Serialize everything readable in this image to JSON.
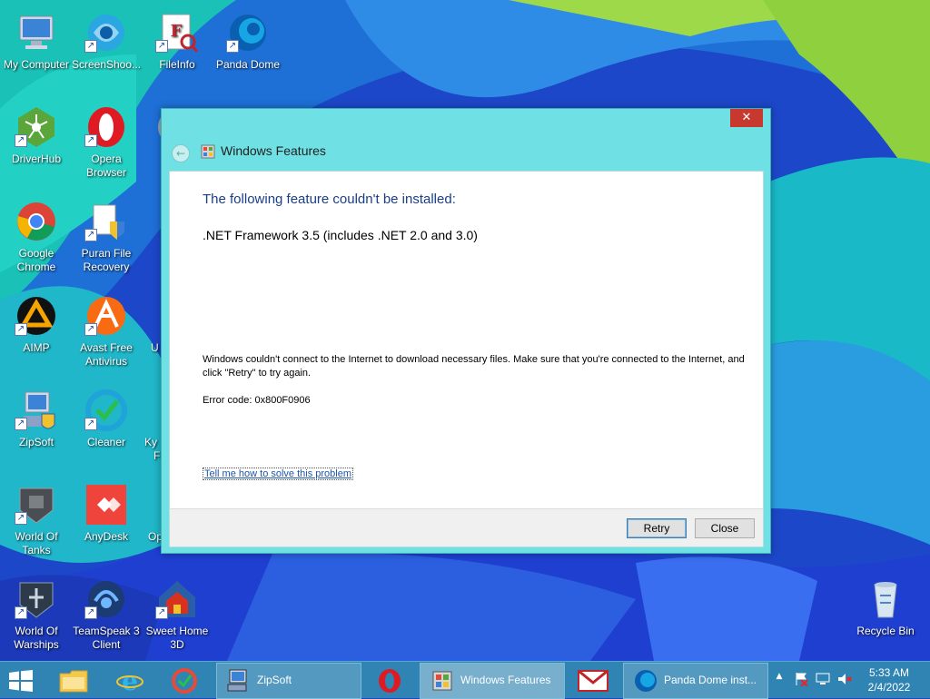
{
  "desktop": {
    "icons": [
      {
        "label": "My Computer"
      },
      {
        "label": "ScreenShoo..."
      },
      {
        "label": "FileInfo"
      },
      {
        "label": "Panda Dome"
      },
      {
        "label": "DriverHub"
      },
      {
        "label": "Opera Browser"
      },
      {
        "label": "Google Chrome"
      },
      {
        "label": "Puran File Recovery"
      },
      {
        "label": "AIMP"
      },
      {
        "label": "Avast Free Antivirus"
      },
      {
        "label": "ZipSoft"
      },
      {
        "label": "Cleaner"
      },
      {
        "label": "World Of Tanks"
      },
      {
        "label": "AnyDesk"
      },
      {
        "label": "World Of Warships"
      },
      {
        "label": "TeamSpeak 3 Client"
      },
      {
        "label": "Sweet Home 3D"
      },
      {
        "label": "Recycle Bin"
      }
    ],
    "partial_labels": [
      "U",
      "Ky",
      "F",
      "Op"
    ]
  },
  "dialog": {
    "title": "Windows Features",
    "close_glyph": "✕",
    "back_glyph": "←",
    "heading": "The following feature couldn't be installed:",
    "feature": ".NET Framework 3.5 (includes .NET 2.0 and 3.0)",
    "message": "Windows couldn't connect to the Internet to download necessary files. Make sure that you're connected to the Internet, and click \"Retry\" to try again.",
    "error_code": "Error code: 0x800F0906",
    "help_link": "Tell me how to solve this problem",
    "retry_label": "Retry",
    "close_label": "Close"
  },
  "taskbar": {
    "apps": [
      {
        "label": "ZipSoft"
      },
      {
        "label": "Windows Features"
      },
      {
        "label": "Panda Dome inst..."
      }
    ],
    "clock_time": "5:33 AM",
    "clock_date": "2/4/2022",
    "tray_up_glyph": "▲"
  },
  "colors": {
    "dialog_frame": "#6fe0e3",
    "heading": "#1a3e8a",
    "close_x": "#c7392e",
    "taskbar": "#2f84b3"
  }
}
